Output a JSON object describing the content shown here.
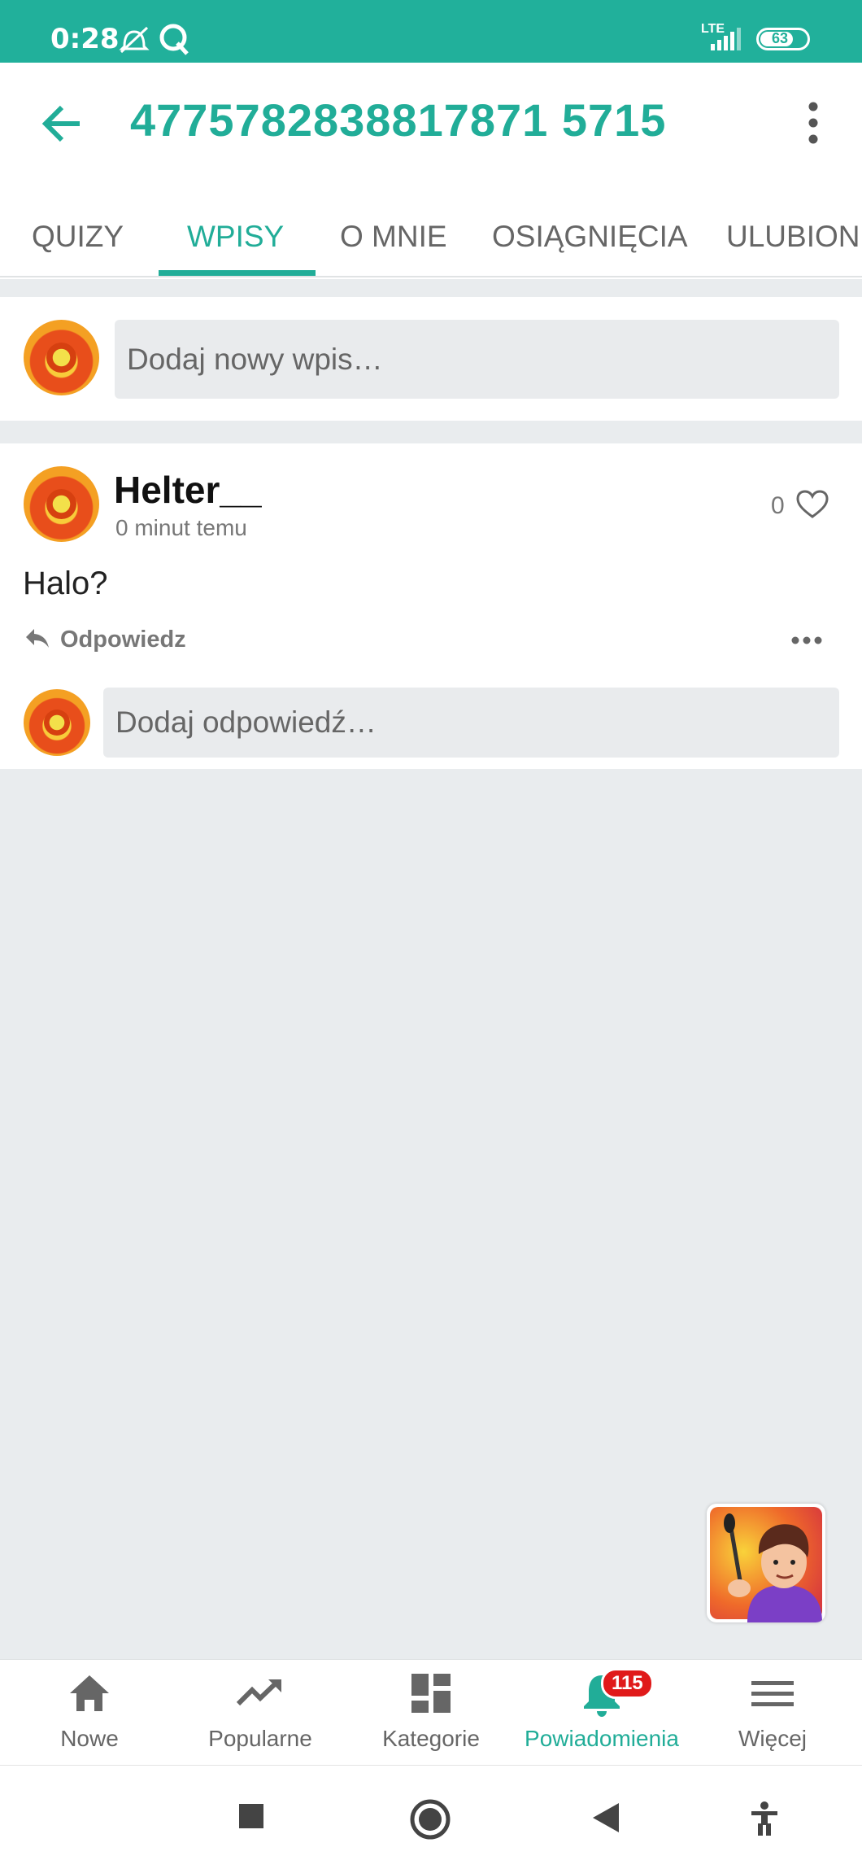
{
  "status_bar": {
    "time": "0:28",
    "network": "LTE",
    "battery": "63"
  },
  "header": {
    "title": "4775782838817871 5715",
    "tabs": [
      "QUIZY",
      "WPISY",
      "O MNIE",
      "OSIĄGNIĘCIA",
      "ULUBION"
    ],
    "active_tab": "WPISY"
  },
  "composer": {
    "placeholder": "Dodaj nowy wpis…"
  },
  "post": {
    "author": "Helter__",
    "time": "0 minut temu",
    "text": "Halo?",
    "likes": "0",
    "reply_label": "Odpowiedz",
    "reply_placeholder": "Dodaj odpowiedź…"
  },
  "bottom_nav": {
    "items": [
      {
        "label": "Nowe",
        "icon": "home-icon"
      },
      {
        "label": "Popularne",
        "icon": "trending-icon"
      },
      {
        "label": "Kategorie",
        "icon": "dashboard-icon"
      },
      {
        "label": "Powiadomienia",
        "icon": "bell-icon"
      },
      {
        "label": "Więcej",
        "icon": "menu-icon"
      }
    ],
    "notifications_badge": "115",
    "active": "Powiadomienia"
  },
  "colors": {
    "accent": "#21ad98",
    "status_bar": "#21b09b",
    "badge": "#e01a1a",
    "background": "#e9ecee"
  }
}
